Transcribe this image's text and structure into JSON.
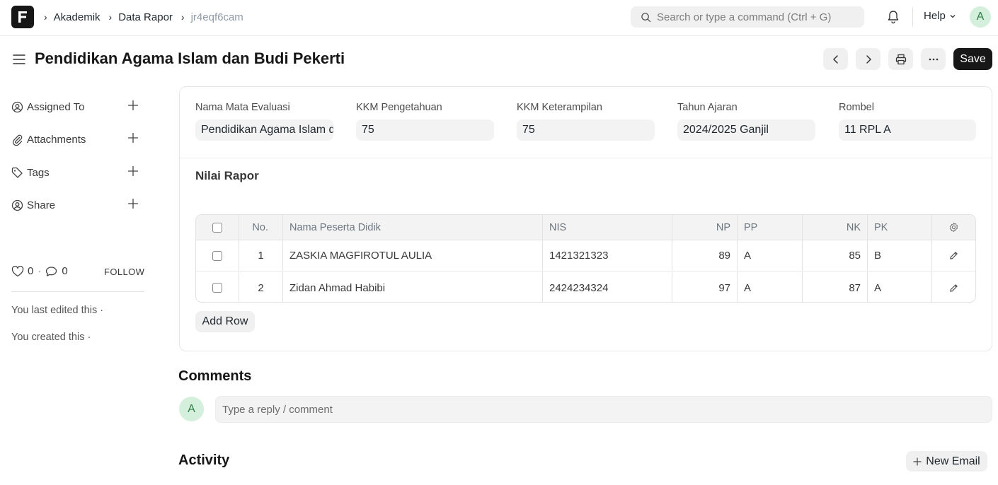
{
  "navbar": {
    "logo_letter": "F",
    "breadcrumbs": [
      "Akademik",
      "Data Rapor",
      "jr4eqf6cam"
    ],
    "search_placeholder": "Search or type a command (Ctrl + G)",
    "help_label": "Help",
    "avatar_letter": "A"
  },
  "page": {
    "title": "Pendidikan Agama Islam dan Budi Pekerti",
    "save_label": "Save"
  },
  "sidebar": {
    "items": [
      {
        "label": "Assigned To",
        "icon": "user-circle-icon"
      },
      {
        "label": "Attachments",
        "icon": "paperclip-icon"
      },
      {
        "label": "Tags",
        "icon": "tag-icon"
      },
      {
        "label": "Share",
        "icon": "user-share-icon"
      }
    ],
    "likes_count": "0",
    "comments_count": "0",
    "follow_label": "FOLLOW",
    "last_edited": "You last edited this ·",
    "created": "You created this ·"
  },
  "form": {
    "fields": [
      {
        "label": "Nama Mata Evaluasi",
        "value": "Pendidikan Agama Islam dan Budi Pekerti"
      },
      {
        "label": "KKM Pengetahuan",
        "value": "75"
      },
      {
        "label": "KKM Keterampilan",
        "value": "75"
      },
      {
        "label": "Tahun Ajaran",
        "value": "2024/2025 Ganjil"
      },
      {
        "label": "Rombel",
        "value": "11 RPL A"
      }
    ],
    "section_title": "Nilai Rapor",
    "table": {
      "columns": [
        "No.",
        "Nama Peserta Didik",
        "NIS",
        "NP",
        "PP",
        "NK",
        "PK"
      ],
      "rows": [
        {
          "no": "1",
          "nama": "ZASKIA MAGFIROTUL AULIA",
          "nis": "1421321323",
          "np": "89",
          "pp": "A",
          "nk": "85",
          "pk": "B"
        },
        {
          "no": "2",
          "nama": "Zidan Ahmad Habibi",
          "nis": "2424234324",
          "np": "97",
          "pp": "A",
          "nk": "87",
          "pk": "A"
        }
      ]
    },
    "add_row_label": "Add Row"
  },
  "comments": {
    "title": "Comments",
    "avatar_letter": "A",
    "placeholder": "Type a reply / comment"
  },
  "activity": {
    "title": "Activity",
    "new_email_label": "New Email"
  }
}
